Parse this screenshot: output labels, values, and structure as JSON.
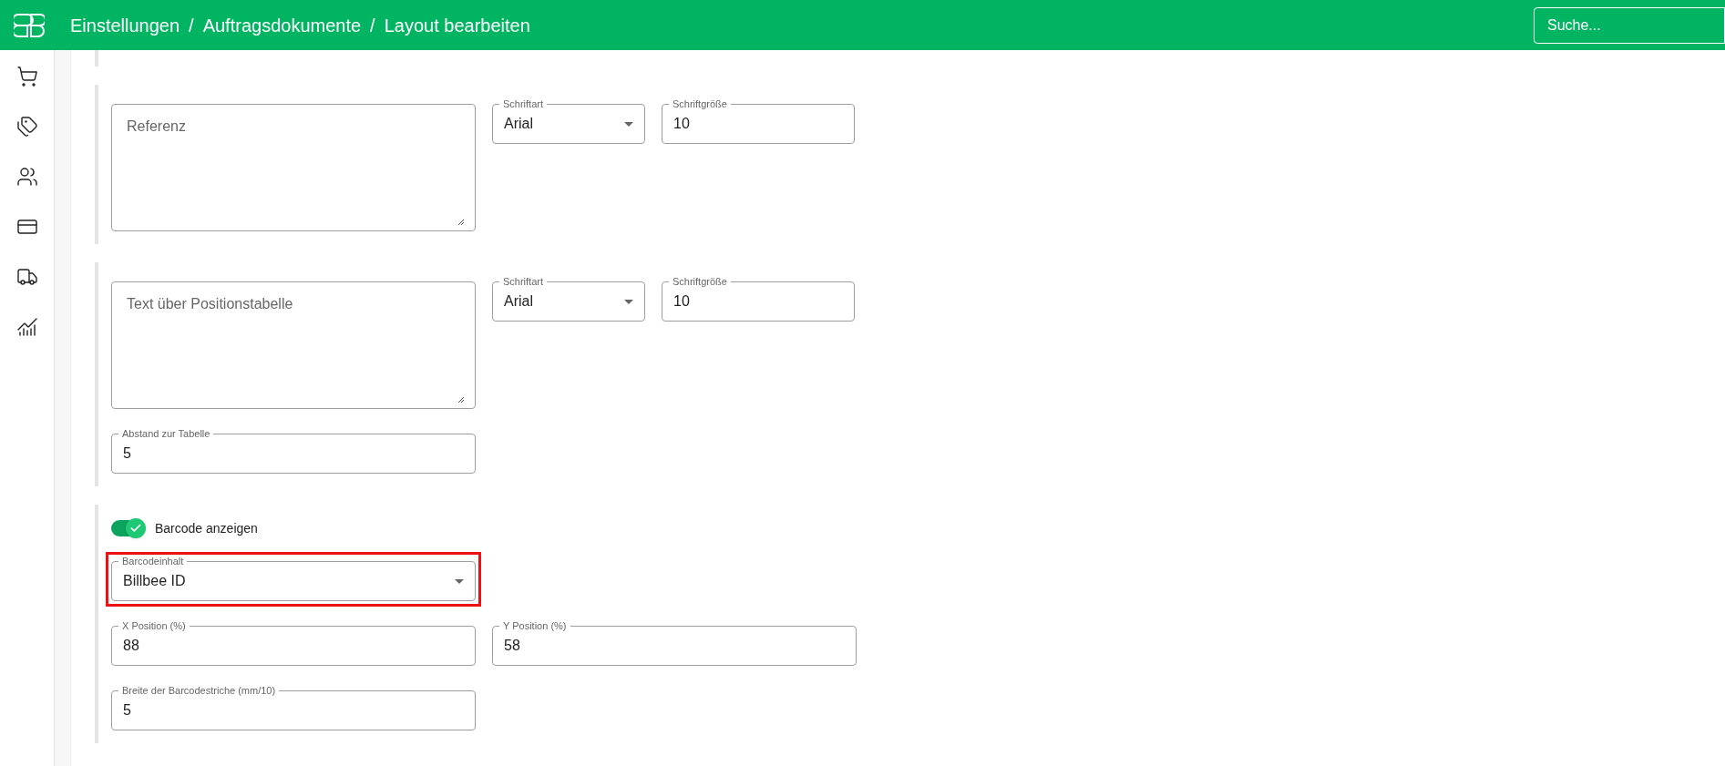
{
  "header": {
    "breadcrumb": [
      "Einstellungen",
      "Auftragsdokumente",
      "Layout bearbeiten"
    ],
    "separator": "/",
    "search": {
      "placeholder": "Suche..."
    }
  },
  "sections": [
    {
      "rows": [
        [
          {
            "kind": "textarea",
            "placeholder": "Referenz"
          },
          {
            "kind": "select",
            "label": "Schriftart",
            "value": "Arial"
          },
          {
            "kind": "text",
            "label": "Schriftgröße",
            "value": "10"
          }
        ]
      ]
    },
    {
      "rows": [
        [
          {
            "kind": "textarea",
            "placeholder": "Text über Positionstabelle"
          },
          {
            "kind": "select",
            "label": "Schriftart",
            "value": "Arial"
          },
          {
            "kind": "text",
            "label": "Schriftgröße",
            "value": "10"
          }
        ],
        [
          {
            "kind": "text",
            "label": "Abstand zur Tabelle",
            "value": "5"
          }
        ]
      ]
    },
    {
      "rows": [
        [
          {
            "kind": "toggle",
            "label": "Barcode anzeigen",
            "on": true
          }
        ],
        [
          {
            "kind": "select",
            "label": "Barcodeinhalt",
            "value": "Billbee ID",
            "highlighted": true
          }
        ],
        [
          {
            "kind": "text",
            "label": "X Position (%)",
            "value": "88"
          },
          {
            "kind": "text",
            "label": "Y Position (%)",
            "value": "58"
          }
        ],
        [
          {
            "kind": "text",
            "label": "Breite der Barcodestriche (mm/10)",
            "value": "5"
          }
        ]
      ]
    }
  ]
}
